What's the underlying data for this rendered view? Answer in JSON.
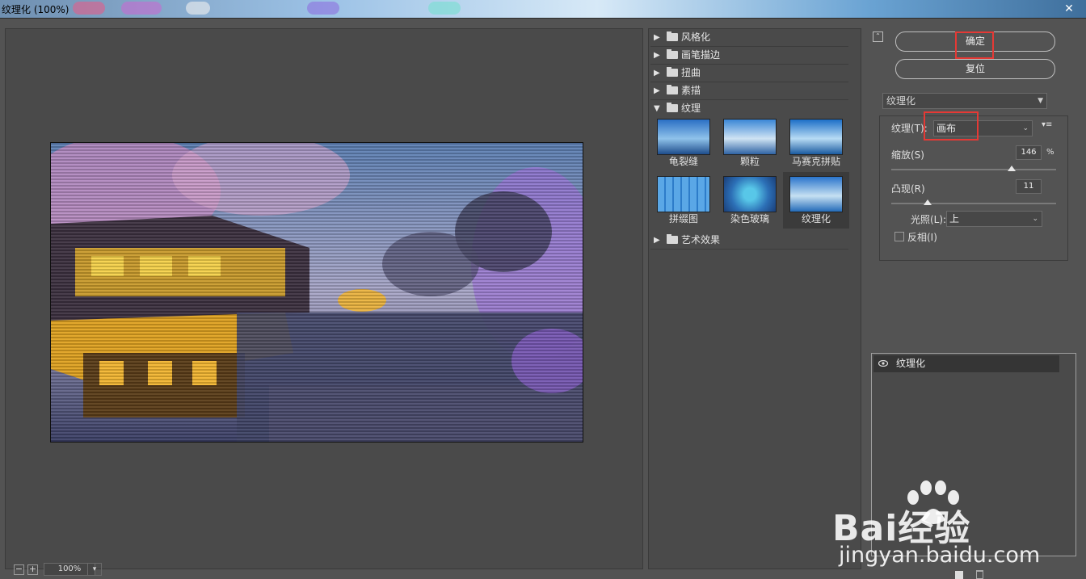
{
  "window": {
    "title": "纹理化 (100%)"
  },
  "preview": {
    "zoom": "100%"
  },
  "filter_gallery": {
    "categories_top": [
      {
        "label": "风格化",
        "expanded": false
      },
      {
        "label": "画笔描边",
        "expanded": false
      },
      {
        "label": "扭曲",
        "expanded": false
      },
      {
        "label": "素描",
        "expanded": false
      },
      {
        "label": "纹理",
        "expanded": true
      }
    ],
    "texture_filters": [
      {
        "label": "龟裂缝"
      },
      {
        "label": "颗粒"
      },
      {
        "label": "马赛克拼贴"
      },
      {
        "label": "拼缀图"
      },
      {
        "label": "染色玻璃"
      },
      {
        "label": "纹理化",
        "selected": true
      }
    ],
    "categories_bottom": [
      {
        "label": "艺术效果",
        "expanded": false
      }
    ]
  },
  "buttons": {
    "ok": "确定",
    "reset": "复位"
  },
  "params": {
    "filter": "纹理化",
    "texture_label": "纹理(T):",
    "texture_value": "画布",
    "scale_label": "缩放(S)",
    "scale_value": "146",
    "scale_unit": "%",
    "scale_level": 0.73,
    "relief_label": "凸现(R)",
    "relief_value": "11",
    "relief_level": 0.22,
    "light_label": "光照(L):",
    "light_value": "上",
    "invert_label": "反相(I)",
    "invert_checked": false
  },
  "effect_layers": [
    {
      "label": "纹理化",
      "visible": true
    }
  ],
  "watermark": {
    "brand": "Bai经验",
    "url": "jingyan.baidu.com"
  },
  "colors": {
    "highlight_box": "#e53935",
    "panel_bg": "#535353"
  }
}
